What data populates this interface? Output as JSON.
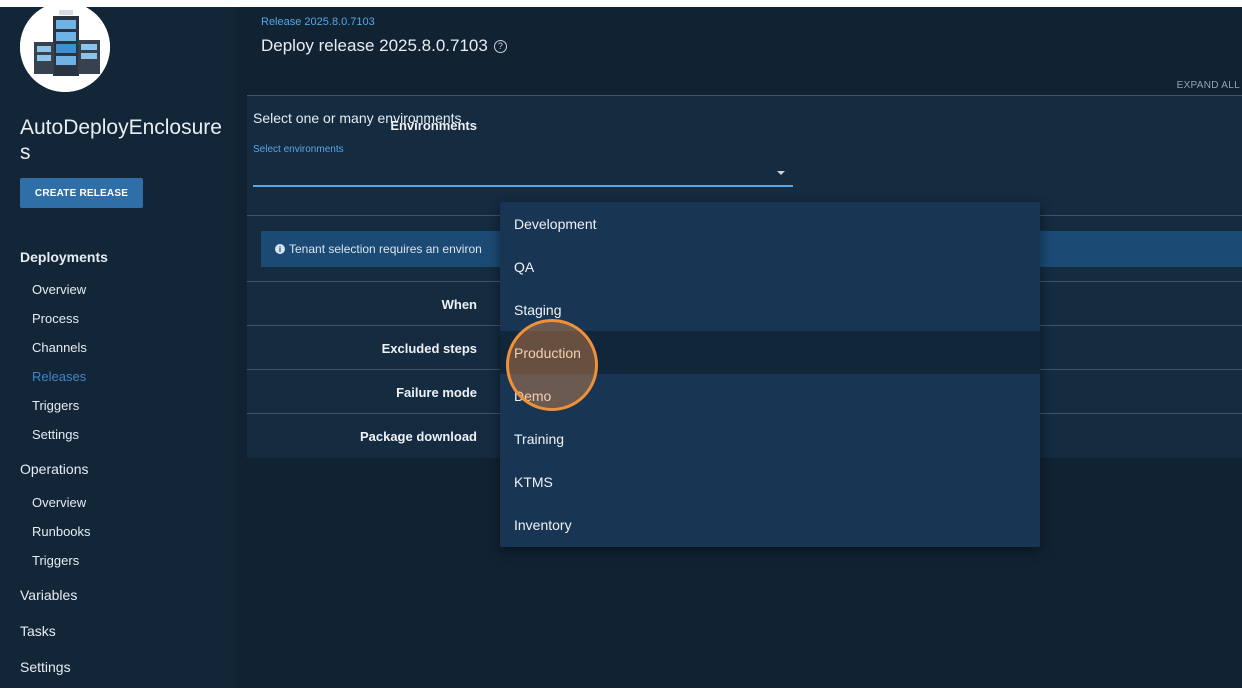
{
  "sidebar": {
    "project_name": "AutoDeployEnclosures",
    "create_release_label": "CREATE RELEASE",
    "deployments": {
      "heading": "Deployments",
      "items": [
        "Overview",
        "Process",
        "Channels",
        "Releases",
        "Triggers",
        "Settings"
      ],
      "active": "Releases"
    },
    "operations": {
      "heading": "Operations",
      "items": [
        "Overview",
        "Runbooks",
        "Triggers"
      ]
    },
    "variables_label": "Variables",
    "tasks_label": "Tasks",
    "settings_label": "Settings"
  },
  "header": {
    "breadcrumb": "Release 2025.8.0.7103",
    "title": "Deploy release 2025.8.0.7103",
    "help_glyph": "?",
    "expand_all_label": "EXPAND ALL"
  },
  "form": {
    "environments_label": "Environments",
    "environments_prompt": "Select one or many environments",
    "select_label": "Select environments",
    "tenant_info": "Tenant selection requires an environ",
    "info_glyph": "i",
    "when_label": "When",
    "excluded_steps_label": "Excluded steps",
    "failure_mode_label": "Failure mode",
    "package_download_label": "Package download"
  },
  "dropdown": {
    "options": [
      "Development",
      "QA",
      "Staging",
      "Production",
      "Demo",
      "Training",
      "KTMS",
      "Inventory"
    ],
    "highlighted": "Production"
  },
  "colors": {
    "background": "#112233",
    "sidebar": "#132638",
    "panel": "#142b40",
    "accent": "#58a6e6",
    "button": "#2f6fa8",
    "dropdown": "#183654",
    "click_highlight": "#f0913a"
  }
}
